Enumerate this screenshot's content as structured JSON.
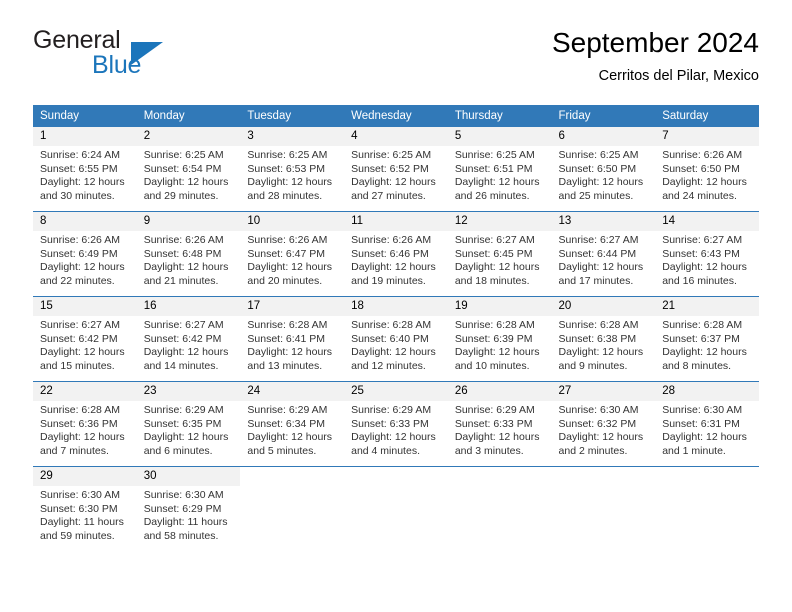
{
  "brand": {
    "name_part1": "General",
    "name_part2": "Blue",
    "logo_icon": "triangle-logo-icon"
  },
  "header": {
    "title": "September 2024",
    "location": "Cerritos del Pilar, Mexico"
  },
  "weekday_headers": [
    "Sunday",
    "Monday",
    "Tuesday",
    "Wednesday",
    "Thursday",
    "Friday",
    "Saturday"
  ],
  "labels": {
    "sunrise_prefix": "Sunrise:",
    "sunset_prefix": "Sunset:",
    "daylight_prefix": "Daylight:"
  },
  "colors": {
    "header_blue": "#3179b8",
    "brand_blue": "#1b75bb",
    "daynum_bg": "#f2f2f2",
    "text": "#333333"
  },
  "weeks": [
    [
      {
        "day": "1",
        "sunrise": "Sunrise: 6:24 AM",
        "sunset": "Sunset: 6:55 PM",
        "daylight": "Daylight: 12 hours and 30 minutes."
      },
      {
        "day": "2",
        "sunrise": "Sunrise: 6:25 AM",
        "sunset": "Sunset: 6:54 PM",
        "daylight": "Daylight: 12 hours and 29 minutes."
      },
      {
        "day": "3",
        "sunrise": "Sunrise: 6:25 AM",
        "sunset": "Sunset: 6:53 PM",
        "daylight": "Daylight: 12 hours and 28 minutes."
      },
      {
        "day": "4",
        "sunrise": "Sunrise: 6:25 AM",
        "sunset": "Sunset: 6:52 PM",
        "daylight": "Daylight: 12 hours and 27 minutes."
      },
      {
        "day": "5",
        "sunrise": "Sunrise: 6:25 AM",
        "sunset": "Sunset: 6:51 PM",
        "daylight": "Daylight: 12 hours and 26 minutes."
      },
      {
        "day": "6",
        "sunrise": "Sunrise: 6:25 AM",
        "sunset": "Sunset: 6:50 PM",
        "daylight": "Daylight: 12 hours and 25 minutes."
      },
      {
        "day": "7",
        "sunrise": "Sunrise: 6:26 AM",
        "sunset": "Sunset: 6:50 PM",
        "daylight": "Daylight: 12 hours and 24 minutes."
      }
    ],
    [
      {
        "day": "8",
        "sunrise": "Sunrise: 6:26 AM",
        "sunset": "Sunset: 6:49 PM",
        "daylight": "Daylight: 12 hours and 22 minutes."
      },
      {
        "day": "9",
        "sunrise": "Sunrise: 6:26 AM",
        "sunset": "Sunset: 6:48 PM",
        "daylight": "Daylight: 12 hours and 21 minutes."
      },
      {
        "day": "10",
        "sunrise": "Sunrise: 6:26 AM",
        "sunset": "Sunset: 6:47 PM",
        "daylight": "Daylight: 12 hours and 20 minutes."
      },
      {
        "day": "11",
        "sunrise": "Sunrise: 6:26 AM",
        "sunset": "Sunset: 6:46 PM",
        "daylight": "Daylight: 12 hours and 19 minutes."
      },
      {
        "day": "12",
        "sunrise": "Sunrise: 6:27 AM",
        "sunset": "Sunset: 6:45 PM",
        "daylight": "Daylight: 12 hours and 18 minutes."
      },
      {
        "day": "13",
        "sunrise": "Sunrise: 6:27 AM",
        "sunset": "Sunset: 6:44 PM",
        "daylight": "Daylight: 12 hours and 17 minutes."
      },
      {
        "day": "14",
        "sunrise": "Sunrise: 6:27 AM",
        "sunset": "Sunset: 6:43 PM",
        "daylight": "Daylight: 12 hours and 16 minutes."
      }
    ],
    [
      {
        "day": "15",
        "sunrise": "Sunrise: 6:27 AM",
        "sunset": "Sunset: 6:42 PM",
        "daylight": "Daylight: 12 hours and 15 minutes."
      },
      {
        "day": "16",
        "sunrise": "Sunrise: 6:27 AM",
        "sunset": "Sunset: 6:42 PM",
        "daylight": "Daylight: 12 hours and 14 minutes."
      },
      {
        "day": "17",
        "sunrise": "Sunrise: 6:28 AM",
        "sunset": "Sunset: 6:41 PM",
        "daylight": "Daylight: 12 hours and 13 minutes."
      },
      {
        "day": "18",
        "sunrise": "Sunrise: 6:28 AM",
        "sunset": "Sunset: 6:40 PM",
        "daylight": "Daylight: 12 hours and 12 minutes."
      },
      {
        "day": "19",
        "sunrise": "Sunrise: 6:28 AM",
        "sunset": "Sunset: 6:39 PM",
        "daylight": "Daylight: 12 hours and 10 minutes."
      },
      {
        "day": "20",
        "sunrise": "Sunrise: 6:28 AM",
        "sunset": "Sunset: 6:38 PM",
        "daylight": "Daylight: 12 hours and 9 minutes."
      },
      {
        "day": "21",
        "sunrise": "Sunrise: 6:28 AM",
        "sunset": "Sunset: 6:37 PM",
        "daylight": "Daylight: 12 hours and 8 minutes."
      }
    ],
    [
      {
        "day": "22",
        "sunrise": "Sunrise: 6:28 AM",
        "sunset": "Sunset: 6:36 PM",
        "daylight": "Daylight: 12 hours and 7 minutes."
      },
      {
        "day": "23",
        "sunrise": "Sunrise: 6:29 AM",
        "sunset": "Sunset: 6:35 PM",
        "daylight": "Daylight: 12 hours and 6 minutes."
      },
      {
        "day": "24",
        "sunrise": "Sunrise: 6:29 AM",
        "sunset": "Sunset: 6:34 PM",
        "daylight": "Daylight: 12 hours and 5 minutes."
      },
      {
        "day": "25",
        "sunrise": "Sunrise: 6:29 AM",
        "sunset": "Sunset: 6:33 PM",
        "daylight": "Daylight: 12 hours and 4 minutes."
      },
      {
        "day": "26",
        "sunrise": "Sunrise: 6:29 AM",
        "sunset": "Sunset: 6:33 PM",
        "daylight": "Daylight: 12 hours and 3 minutes."
      },
      {
        "day": "27",
        "sunrise": "Sunrise: 6:30 AM",
        "sunset": "Sunset: 6:32 PM",
        "daylight": "Daylight: 12 hours and 2 minutes."
      },
      {
        "day": "28",
        "sunrise": "Sunrise: 6:30 AM",
        "sunset": "Sunset: 6:31 PM",
        "daylight": "Daylight: 12 hours and 1 minute."
      }
    ],
    [
      {
        "day": "29",
        "sunrise": "Sunrise: 6:30 AM",
        "sunset": "Sunset: 6:30 PM",
        "daylight": "Daylight: 11 hours and 59 minutes."
      },
      {
        "day": "30",
        "sunrise": "Sunrise: 6:30 AM",
        "sunset": "Sunset: 6:29 PM",
        "daylight": "Daylight: 11 hours and 58 minutes."
      },
      {
        "day": "",
        "sunrise": "",
        "sunset": "",
        "daylight": ""
      },
      {
        "day": "",
        "sunrise": "",
        "sunset": "",
        "daylight": ""
      },
      {
        "day": "",
        "sunrise": "",
        "sunset": "",
        "daylight": ""
      },
      {
        "day": "",
        "sunrise": "",
        "sunset": "",
        "daylight": ""
      },
      {
        "day": "",
        "sunrise": "",
        "sunset": "",
        "daylight": ""
      }
    ]
  ]
}
